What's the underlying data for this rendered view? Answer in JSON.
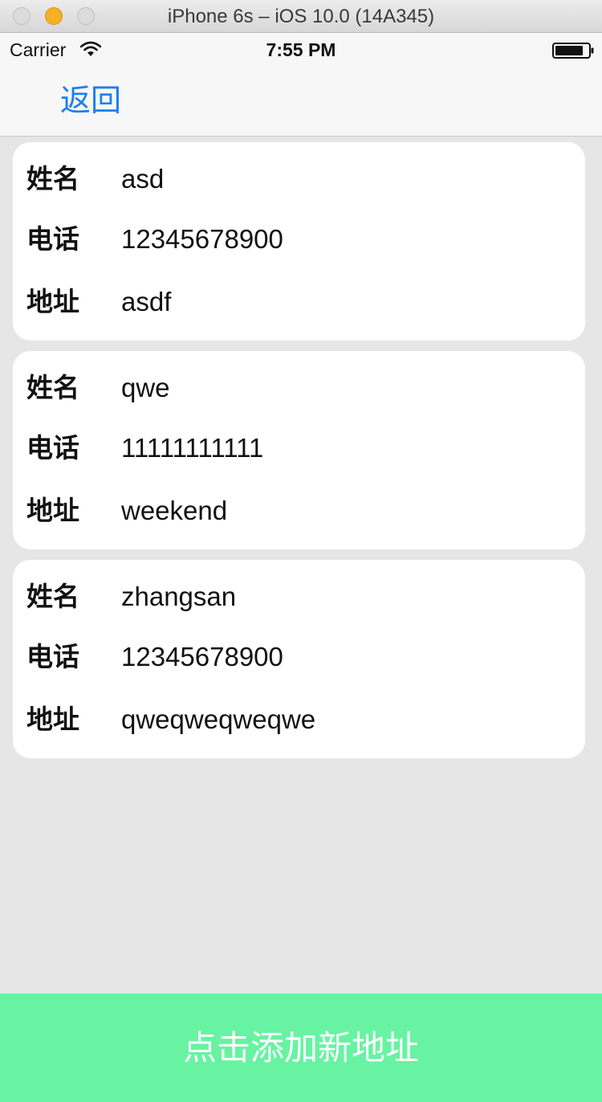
{
  "window": {
    "title": "iPhone 6s – iOS 10.0 (14A345)"
  },
  "status_bar": {
    "carrier": "Carrier",
    "time": "7:55 PM",
    "icons": [
      "wifi-icon",
      "battery-icon"
    ]
  },
  "nav": {
    "back_label": "返回"
  },
  "addresses": [
    {
      "name_label": "姓名",
      "name": "asd",
      "phone_label": "电话",
      "phone": "12345678900",
      "address_label": "地址",
      "address": "asdf"
    },
    {
      "name_label": "姓名",
      "name": "qwe",
      "phone_label": "电话",
      "phone": "11111111111",
      "address_label": "地址",
      "address": "weekend"
    },
    {
      "name_label": "姓名",
      "name": "zhangsan",
      "phone_label": "电话",
      "phone": "12345678900",
      "address_label": "地址",
      "address": "qweqweqweqwe"
    }
  ],
  "add_button": {
    "label": "点击添加新地址"
  },
  "colors": {
    "accent_blue": "#1a7ff0",
    "add_button_green": "#67f3a2",
    "background": "#e6e6e6",
    "card": "#ffffff"
  }
}
